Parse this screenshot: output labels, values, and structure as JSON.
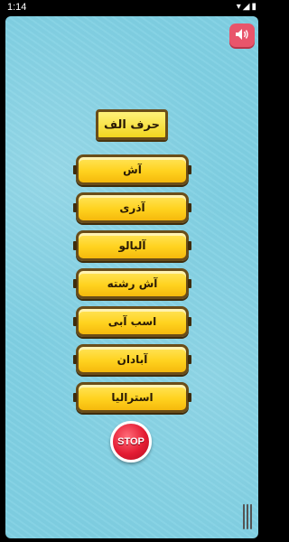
{
  "status": {
    "time": "1:14",
    "icons": "▾◢▮"
  },
  "title": "حرف الف",
  "words": [
    "آش",
    "آذری",
    "آلبالو",
    "آش رشته",
    "اسب آبی",
    "آبادان",
    "استرالیا"
  ],
  "stop_label": "STOP",
  "colors": {
    "background": "#7fd0e3",
    "button": "#ffd21f",
    "border": "#6a4d19",
    "stop": "#e41c33",
    "sound": "#e8556b"
  }
}
